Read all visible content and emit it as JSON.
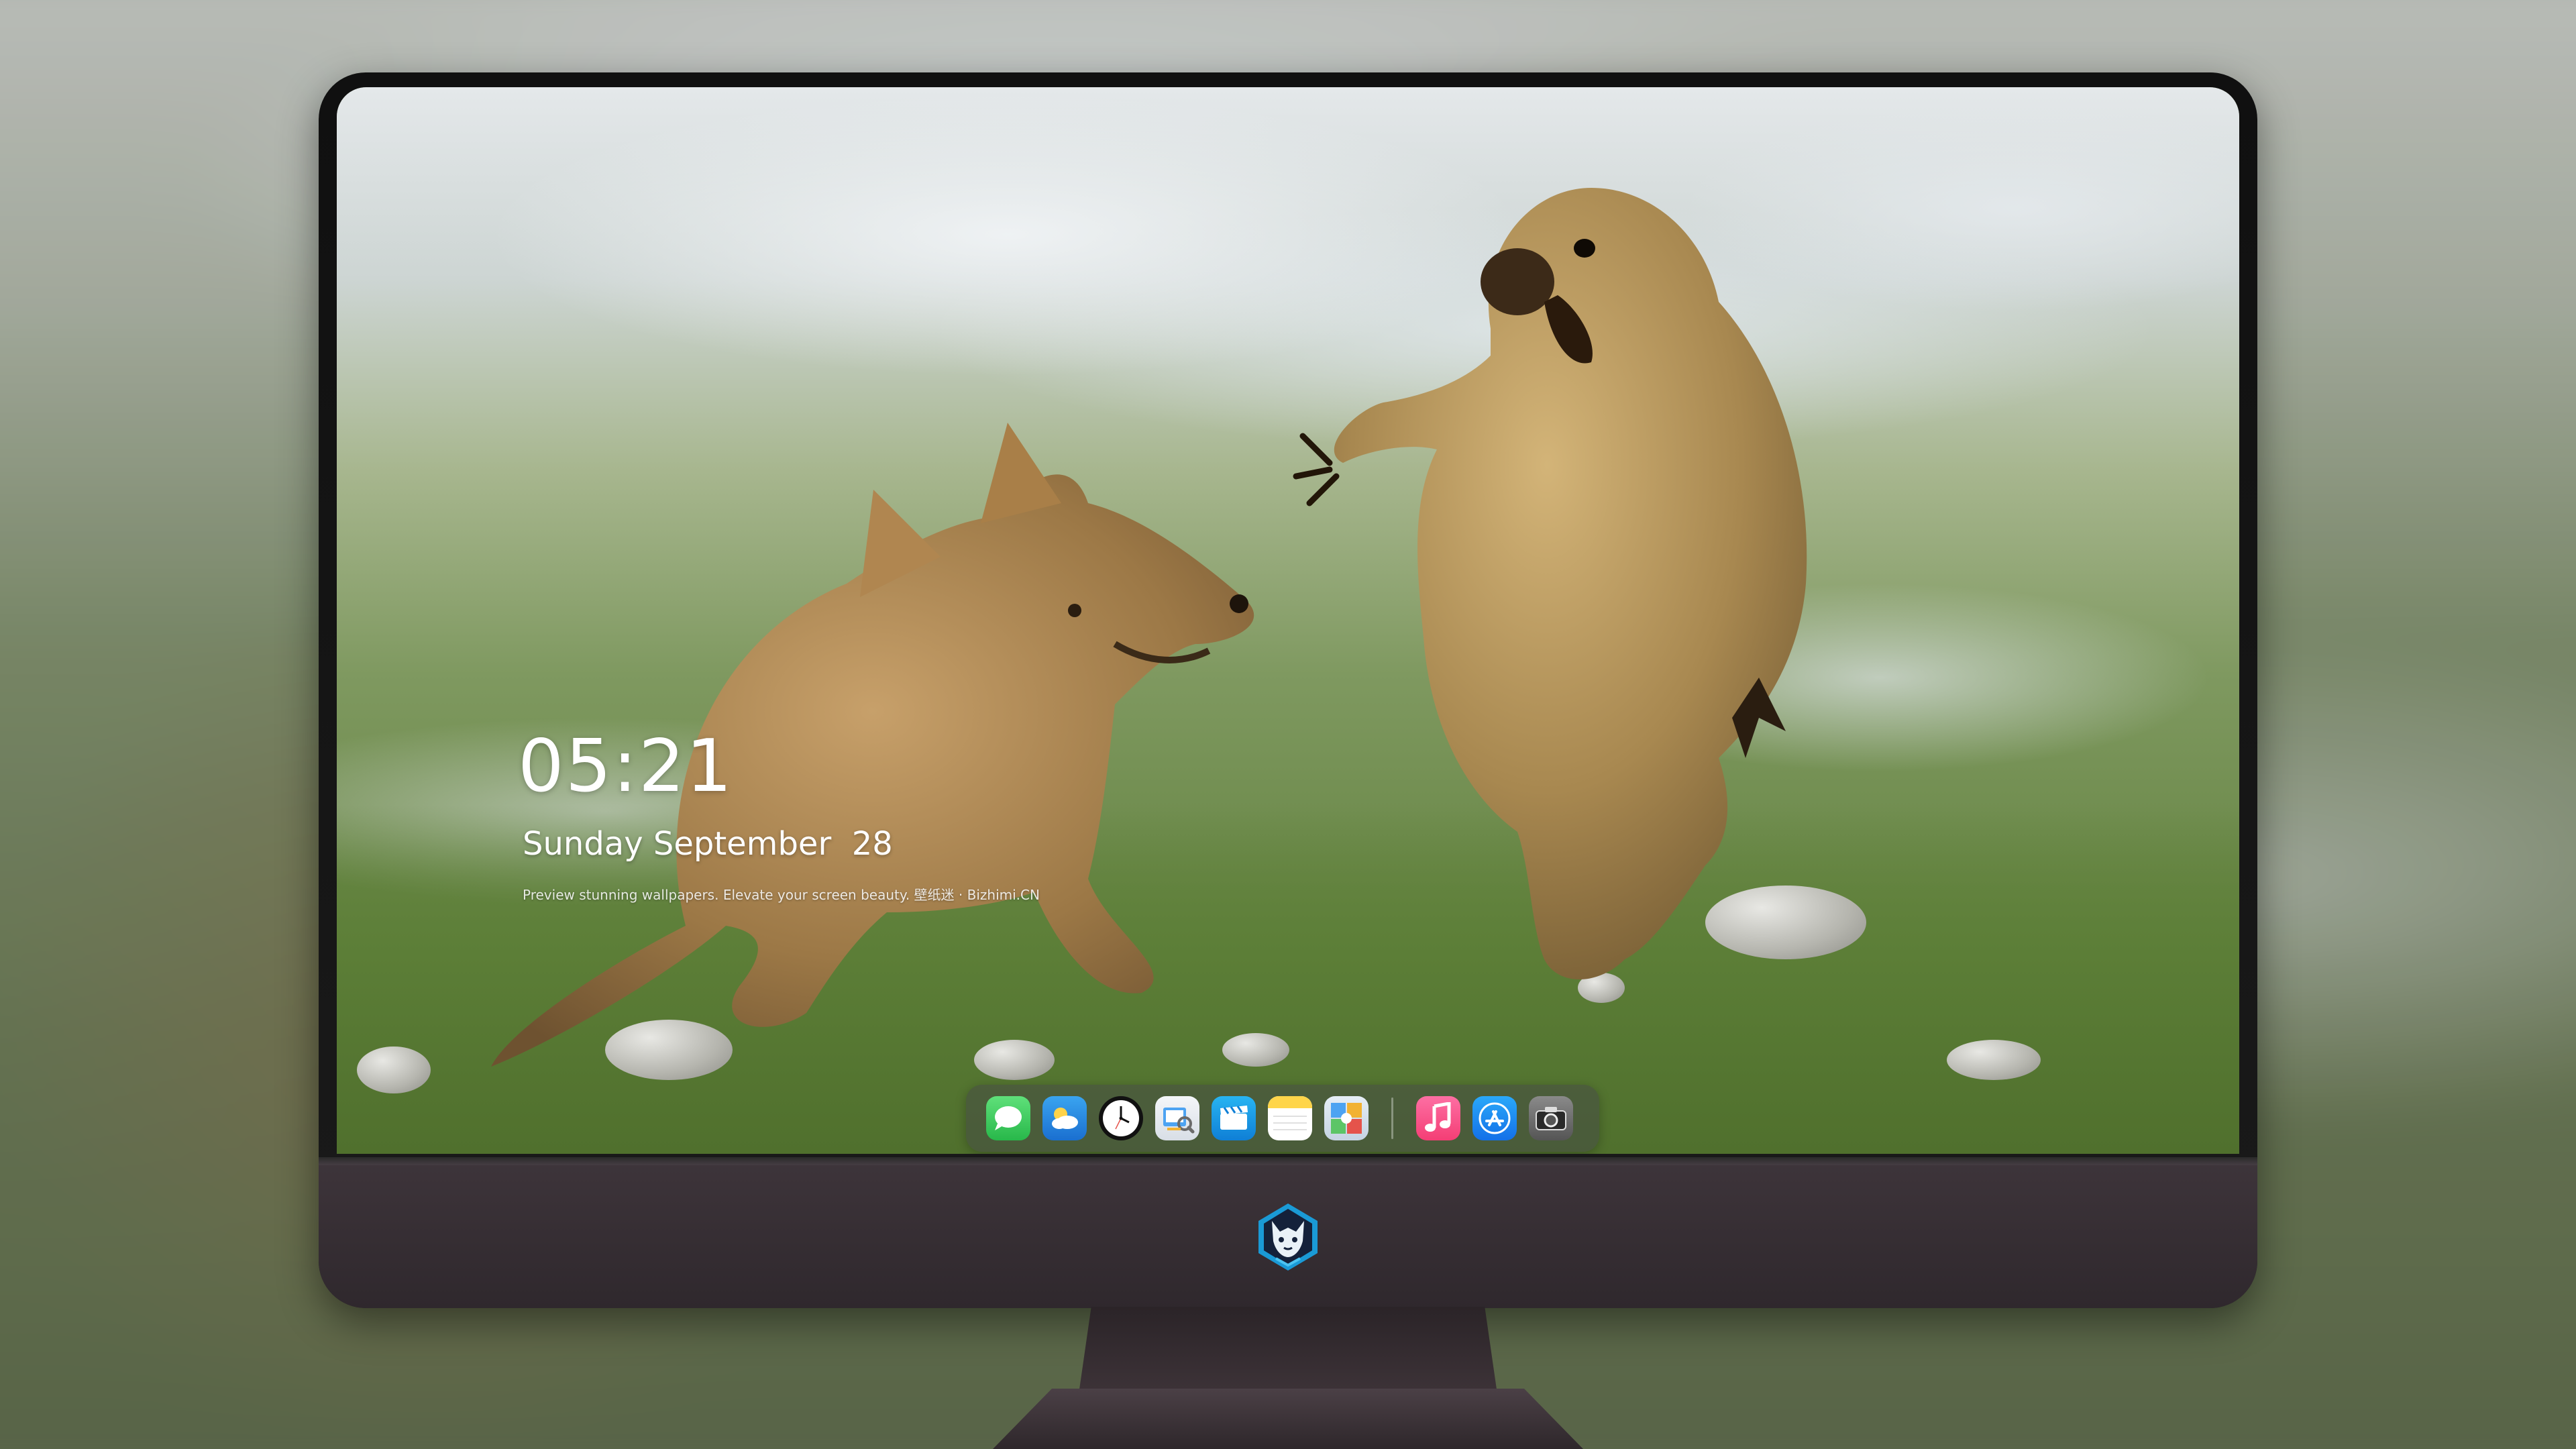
{
  "lock_screen": {
    "time": "05:21",
    "date": "Sunday September  28",
    "tagline": "Preview stunning wallpapers. Elevate your screen beauty. 壁纸迷 · Bizhimi.CN"
  },
  "dock": {
    "apps": [
      {
        "name": "Messages",
        "icon": "messages-icon",
        "color": "#34c759"
      },
      {
        "name": "Weather",
        "icon": "weather-icon",
        "color": "#2f8de4"
      },
      {
        "name": "Clock",
        "icon": "clock-icon",
        "color": "#111111"
      },
      {
        "name": "Preview",
        "icon": "preview-icon",
        "color": "#e9eef5"
      },
      {
        "name": "Clips",
        "icon": "clips-icon",
        "color": "#1aa0e8"
      },
      {
        "name": "Notes",
        "icon": "notes-icon",
        "color": "#ffd54a"
      },
      {
        "name": "Photo Booth",
        "icon": "photo-booth-icon",
        "color": "#d8e4f0"
      },
      {
        "name": "Music",
        "icon": "music-icon",
        "color": "#fb4d8a"
      },
      {
        "name": "App Store",
        "icon": "app-store-icon",
        "color": "#1c8cf2"
      },
      {
        "name": "Screenshot",
        "icon": "camera-icon",
        "color": "#6a6a6a"
      }
    ]
  },
  "monitor": {
    "logo": "fox-mascot-logo"
  }
}
